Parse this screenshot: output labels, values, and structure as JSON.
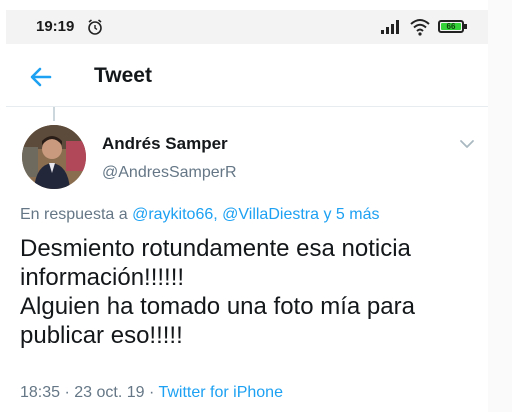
{
  "status_bar": {
    "time": "19:19",
    "battery_level": "66",
    "icons": [
      "alarm-icon",
      "signal-icon",
      "wifi-icon",
      "battery-icon"
    ]
  },
  "header": {
    "title": "Tweet",
    "back_icon": "back-arrow-icon"
  },
  "tweet": {
    "author_name": "Andrés Samper",
    "author_handle": "@AndresSamperR",
    "reply_prefix": "En respuesta a",
    "reply_users": [
      "@raykito66",
      "@VillaDiestra"
    ],
    "reply_separator": ", ",
    "reply_more": "y 5 más",
    "text_lines": [
      "Desmiento rotundamente esa noticia información!!!!!!",
      "Alguien ha tomado una foto mía para publicar eso!!!!!"
    ],
    "timestamp": "18:35 · 23 oct. 19",
    "meta_separator": " · ",
    "source": "Twitter for iPhone"
  },
  "colors": {
    "accent": "#1da1f2",
    "text": "#14171a",
    "secondary_text": "#657786",
    "battery": "#35d33a"
  }
}
